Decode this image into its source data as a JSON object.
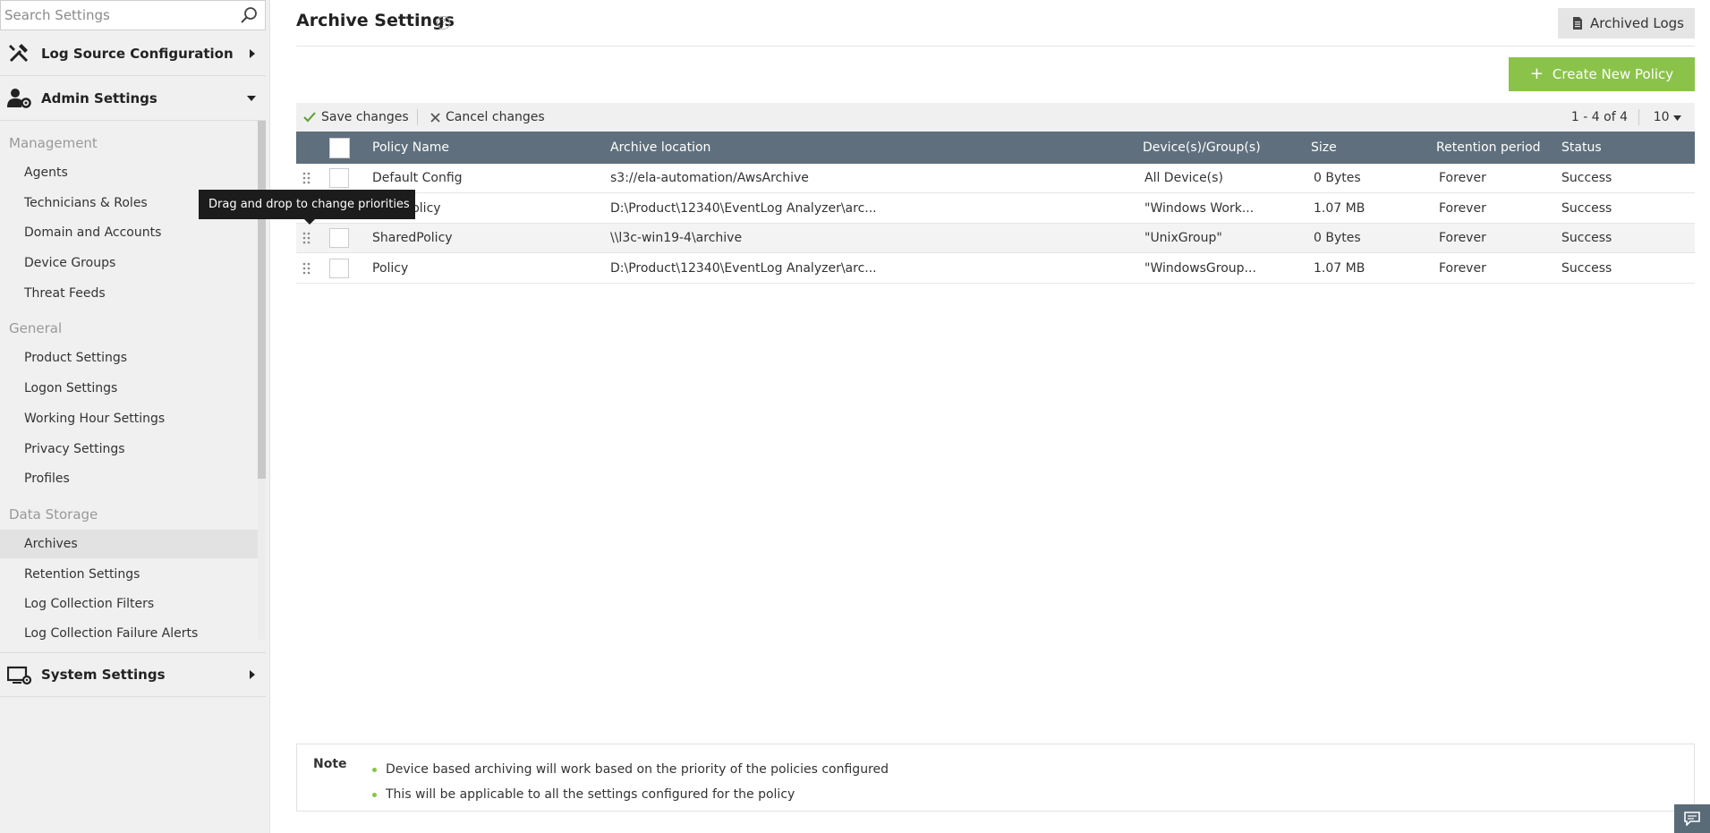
{
  "sidebar": {
    "search_placeholder": "Search Settings",
    "sections": {
      "log_source": "Log Source Configuration",
      "admin": "Admin Settings",
      "system": "System Settings"
    },
    "groups": {
      "management": "Management",
      "general": "General",
      "data_storage": "Data Storage"
    },
    "management_items": [
      "Agents",
      "Technicians & Roles",
      "Domain and Accounts",
      "Device Groups",
      "Threat Feeds"
    ],
    "general_items": [
      "Product Settings",
      "Logon Settings",
      "Working Hour Settings",
      "Privacy Settings",
      "Profiles"
    ],
    "data_storage_items": [
      "Archives",
      "Retention Settings",
      "Log Collection Filters",
      "Log Collection Failure Alerts"
    ]
  },
  "header": {
    "title": "Archive Settings",
    "help": "?",
    "archived_logs_label": "Archived Logs"
  },
  "actions": {
    "create_label": "Create New Policy",
    "save_label": "Save changes",
    "cancel_label": "Cancel changes",
    "pagination": "1 - 4 of 4",
    "per_page": "10"
  },
  "table": {
    "columns": {
      "name": "Policy Name",
      "location": "Archive location",
      "devices": "Device(s)/Group(s)",
      "size": "Size",
      "retention": "Retention period",
      "status": "Status"
    },
    "rows": [
      {
        "name": "Default Config",
        "location": "s3://ela-automation/AwsArchive",
        "devices": "All Device(s)",
        "size": "0 Bytes",
        "retention": "Forever",
        "status": "Success"
      },
      {
        "name": "LocalPolicy",
        "location": "D:\\Product\\12340\\EventLog Analyzer\\arc...",
        "devices": "\"Windows Work...",
        "size": "1.07 MB",
        "retention": "Forever",
        "status": "Success"
      },
      {
        "name": "SharedPolicy",
        "location": "\\\\l3c-win19-4\\archive",
        "devices": "\"UnixGroup\"",
        "size": "0 Bytes",
        "retention": "Forever",
        "status": "Success"
      },
      {
        "name": "Policy",
        "location": "D:\\Product\\12340\\EventLog Analyzer\\arc...",
        "devices": "\"WindowsGroup...",
        "size": "1.07 MB",
        "retention": "Forever",
        "status": "Success"
      }
    ]
  },
  "tooltip": "Drag and drop to change priorities",
  "note": {
    "label": "Note",
    "items": [
      "Device based archiving will work based on the priority of the policies configured",
      "This will be applicable to all the settings configured for the policy"
    ]
  },
  "colors": {
    "accent": "#8bc34a",
    "table_header": "#5f6f7d",
    "sidebar_bg": "#f0f0f0"
  }
}
